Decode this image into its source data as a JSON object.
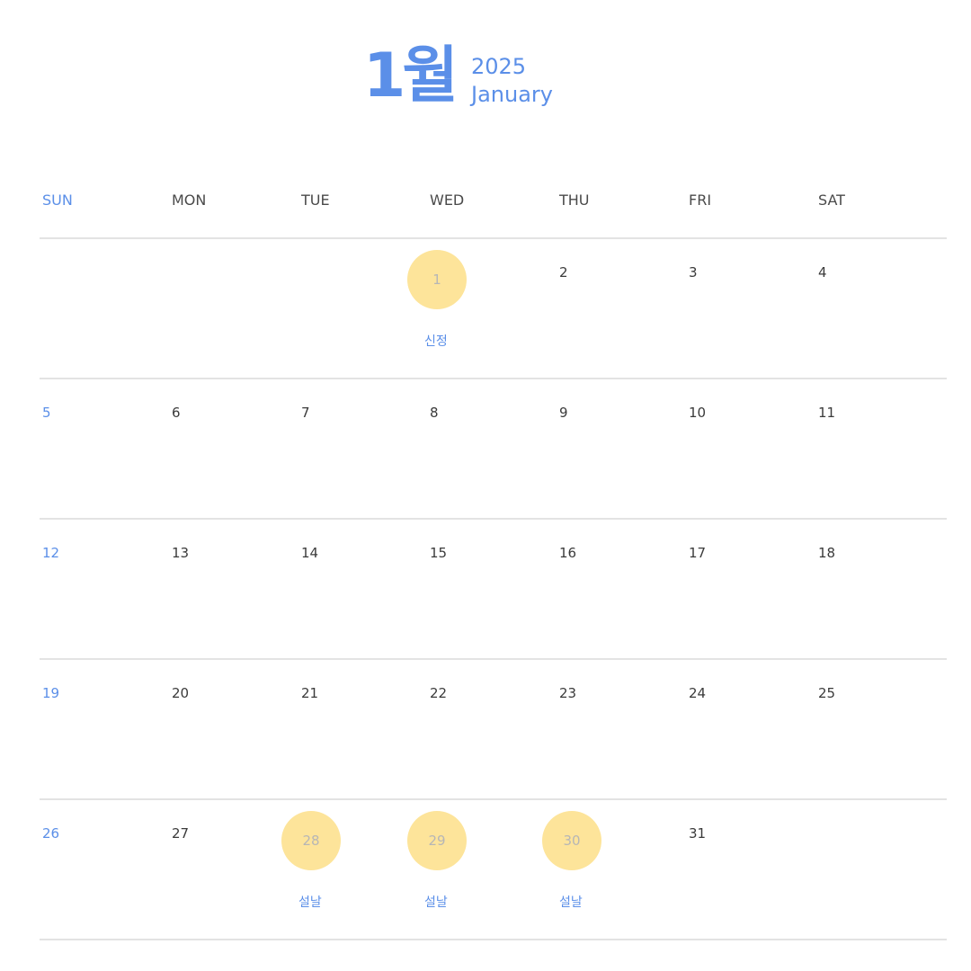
{
  "header": {
    "month_ko": "1월",
    "year": "2025",
    "month_en": "January"
  },
  "weekdays": [
    "SUN",
    "MON",
    "TUE",
    "WED",
    "THU",
    "FRI",
    "SAT"
  ],
  "weeks": [
    [
      "",
      "",
      "",
      "1",
      "2",
      "3",
      "4"
    ],
    [
      "5",
      "6",
      "7",
      "8",
      "9",
      "10",
      "11"
    ],
    [
      "12",
      "13",
      "14",
      "15",
      "16",
      "17",
      "18"
    ],
    [
      "19",
      "20",
      "21",
      "22",
      "23",
      "24",
      "25"
    ],
    [
      "26",
      "27",
      "28",
      "29",
      "30",
      "31",
      ""
    ]
  ],
  "holidays": [
    {
      "day": "1",
      "label": "신정"
    },
    {
      "day": "28",
      "label": "설날"
    },
    {
      "day": "29",
      "label": "설날"
    },
    {
      "day": "30",
      "label": "설날"
    }
  ],
  "colors": {
    "accent": "#5b8fe8",
    "holiday_fill": "#fde49a",
    "text": "#3a3a3a",
    "grid_line": "#e3e3e3"
  }
}
